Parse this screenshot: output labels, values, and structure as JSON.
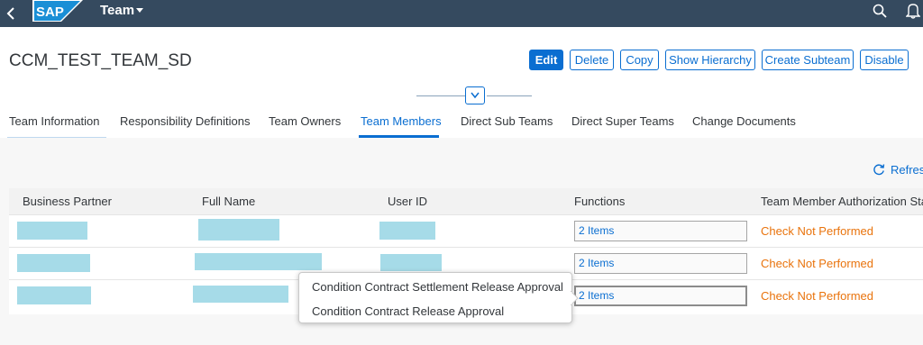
{
  "shell": {
    "app_title": "Team",
    "logo_text": "SAP",
    "colors": {
      "shell_bg": "#354a5f",
      "brand": "#0a6ed1"
    },
    "icons": [
      "back-icon",
      "sap-logo",
      "dropdown-caret-icon",
      "search-icon",
      "bell-icon"
    ]
  },
  "header": {
    "object_title": "CCM_TEST_TEAM_SD",
    "actions": {
      "edit": "Edit",
      "delete": "Delete",
      "copy": "Copy",
      "show_hierarchy": "Show Hierarchy",
      "create_subteam": "Create Subteam",
      "disable": "Disable"
    }
  },
  "tabs": [
    {
      "label": "Team Information"
    },
    {
      "label": "Responsibility Definitions"
    },
    {
      "label": "Team Owners"
    },
    {
      "label": "Team Members",
      "selected": true
    },
    {
      "label": "Direct Sub Teams"
    },
    {
      "label": "Direct Super Teams"
    },
    {
      "label": "Change Documents"
    }
  ],
  "members": {
    "refresh_label": "Refres",
    "columns": [
      "Business Partner",
      "Full Name",
      "User ID",
      "Functions",
      "Team Member Authorization Statu"
    ],
    "rows": [
      {
        "functions": "2 Items",
        "status": "Check Not Performed"
      },
      {
        "functions": "2 Items",
        "status": "Check Not Performed"
      },
      {
        "functions": "2 Items",
        "status": "Check Not Performed"
      }
    ],
    "status_color": "#e9730c",
    "redaction_color": "#a6dbe8"
  },
  "popover": {
    "items": [
      "Condition Contract Settlement Release Approval",
      "Condition Contract Release Approval"
    ]
  }
}
